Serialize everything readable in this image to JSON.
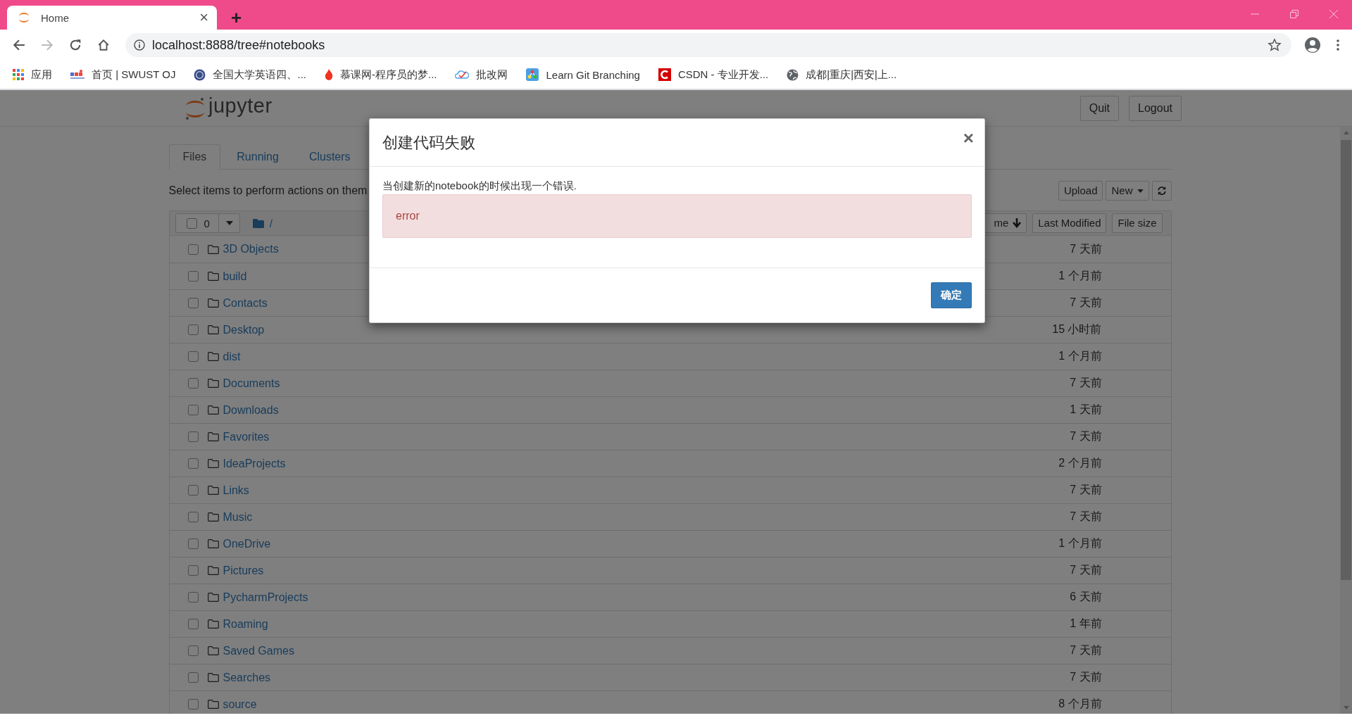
{
  "browser": {
    "tab": {
      "title": "Home",
      "close": "×"
    },
    "new_tab": "+",
    "url": "localhost:8888/tree#notebooks",
    "bookmarks": [
      {
        "label": "应用"
      },
      {
        "label": "首页 | SWUST OJ"
      },
      {
        "label": "全国大学英语四、..."
      },
      {
        "label": "慕课网-程序员的梦..."
      },
      {
        "label": "批改网"
      },
      {
        "label": "Learn Git Branching"
      },
      {
        "label": "CSDN - 专业开发..."
      },
      {
        "label": "成都|重庆|西安|上..."
      }
    ]
  },
  "header": {
    "logo": "jupyter",
    "buttons": [
      "Quit",
      "Logout"
    ]
  },
  "tabs": [
    {
      "label": "Files",
      "selected": true
    },
    {
      "label": "Running",
      "selected": false
    },
    {
      "label": "Clusters",
      "selected": false
    }
  ],
  "toolbar": {
    "hint": "Select items to perform actions on them",
    "buttons": [
      {
        "label": "Upload",
        "dropdown": false
      },
      {
        "label": "New",
        "dropdown": true
      }
    ]
  },
  "list_header": {
    "selected_count": "0",
    "checked": false,
    "breadcrumb": "/",
    "sort_buttons": [
      {
        "label": "me",
        "sorted": true
      },
      {
        "label": "Last Modified",
        "sorted": false
      },
      {
        "label": "File size",
        "sorted": false
      }
    ]
  },
  "rows": [
    {
      "name": "3D Objects",
      "modified": "7 天前",
      "checked": false
    },
    {
      "name": "build",
      "modified": "1 个月前",
      "checked": false
    },
    {
      "name": "Contacts",
      "modified": "7 天前",
      "checked": false
    },
    {
      "name": "Desktop",
      "modified": "15 小时前",
      "checked": false
    },
    {
      "name": "dist",
      "modified": "1 个月前",
      "checked": false
    },
    {
      "name": "Documents",
      "modified": "7 天前",
      "checked": false
    },
    {
      "name": "Downloads",
      "modified": "1 天前",
      "checked": false
    },
    {
      "name": "Favorites",
      "modified": "7 天前",
      "checked": false
    },
    {
      "name": "IdeaProjects",
      "modified": "2 个月前",
      "checked": false
    },
    {
      "name": "Links",
      "modified": "7 天前",
      "checked": false
    },
    {
      "name": "Music",
      "modified": "7 天前",
      "checked": false
    },
    {
      "name": "OneDrive",
      "modified": "1 个月前",
      "checked": false
    },
    {
      "name": "Pictures",
      "modified": "7 天前",
      "checked": false
    },
    {
      "name": "PycharmProjects",
      "modified": "6 天前",
      "checked": false
    },
    {
      "name": "Roaming",
      "modified": "1 年前",
      "checked": false
    },
    {
      "name": "Saved Games",
      "modified": "7 天前",
      "checked": false
    },
    {
      "name": "Searches",
      "modified": "7 天前",
      "checked": false
    },
    {
      "name": "source",
      "modified": "8 个月前",
      "checked": false
    }
  ],
  "dialog": {
    "title": "创建代码失败",
    "close": "×",
    "message": "当创建新的notebook的时候出现一个错误.",
    "alert": "error",
    "button": "确定"
  }
}
